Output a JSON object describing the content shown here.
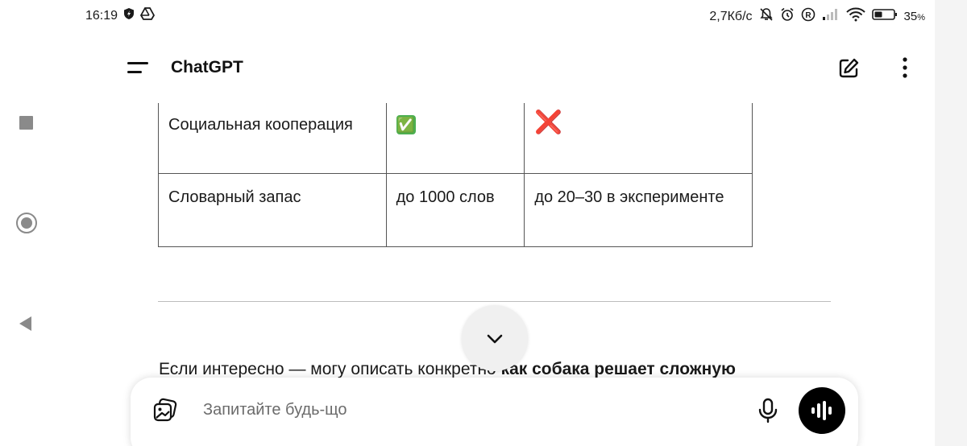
{
  "status_bar": {
    "time": "16:19",
    "net_speed": "2,7Кб/с",
    "battery_percent": "35",
    "battery_unit": "%",
    "icons": [
      "shield-icon",
      "drive-icon",
      "mute-bell-icon",
      "alarm-icon",
      "registered-icon",
      "signal-icon",
      "wifi-icon",
      "battery-icon"
    ]
  },
  "header": {
    "title": "ChatGPT",
    "icons": [
      "menu-icon",
      "edit-icon",
      "more-icon"
    ]
  },
  "table": {
    "rows": [
      {
        "feature": "Социальная кооперация",
        "col2": "✅",
        "col3": "❌"
      },
      {
        "feature": "Словарный запас",
        "col2": "до 1000 слов",
        "col3": "до 20–30 в эксперименте"
      }
    ]
  },
  "followup": {
    "text_start": "Если интересно — могу описать конкретно ",
    "text_bold": "как собака решает сложную"
  },
  "composer": {
    "placeholder": "Запитайте будь-що",
    "value": "",
    "icons": [
      "attach-image-icon",
      "microphone-icon",
      "voice-mode-icon"
    ]
  },
  "colors": {
    "check_green": "#4caf50",
    "cross_red": "#d32f2f",
    "voice_button_bg": "#000000"
  }
}
